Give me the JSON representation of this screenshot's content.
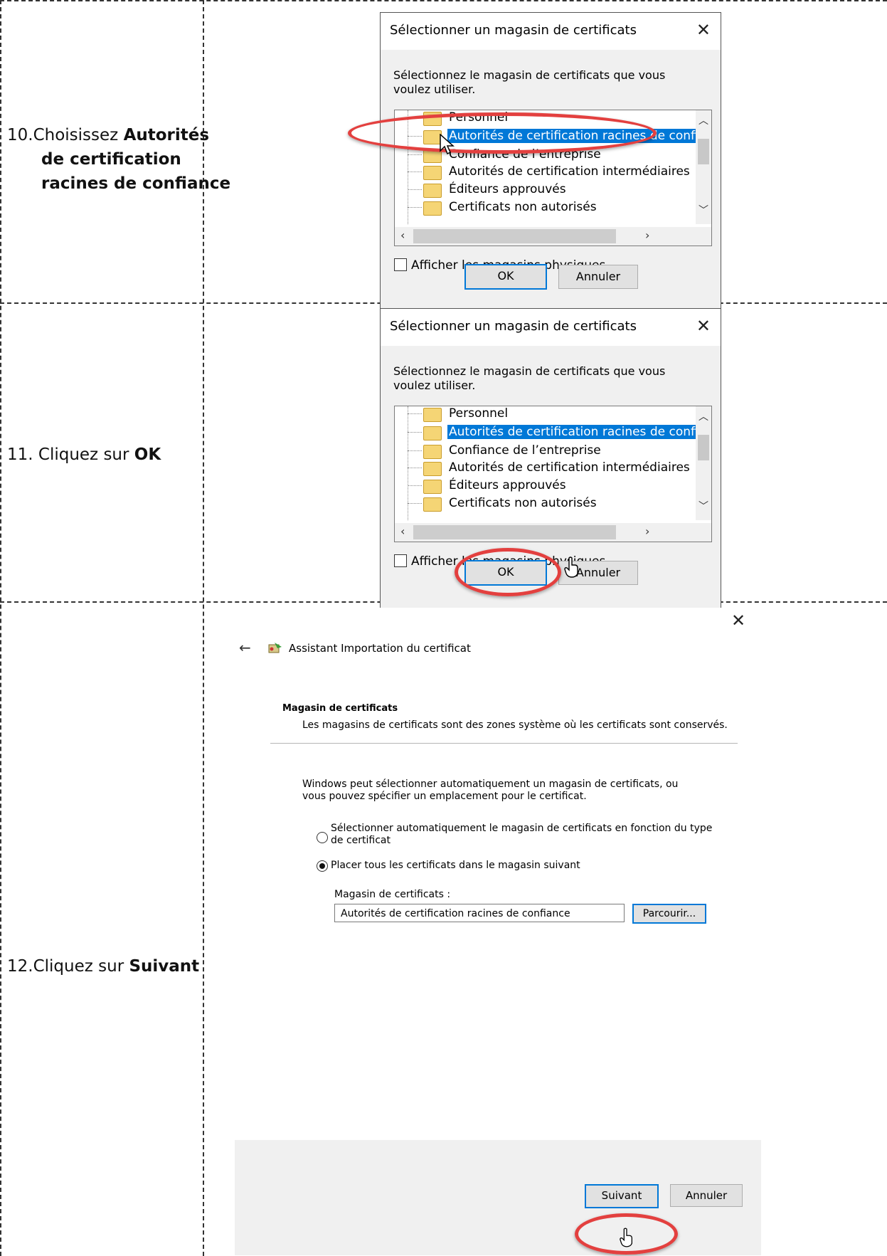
{
  "rows": [
    {
      "step_prefix": "10.Choisissez ",
      "step_bold_1": "Autorités",
      "step_bold_2": "de certification",
      "step_bold_3": "racines de confiance"
    },
    {
      "step_prefix": "11. Cliquez sur ",
      "step_bold": "OK"
    },
    {
      "step_prefix": "12.Cliquez sur ",
      "step_bold": "Suivant"
    }
  ],
  "dialog": {
    "title": "Sélectionner un magasin de certificats",
    "close_glyph": "✕",
    "description": "Sélectionnez le magasin de certificats que vous voulez utiliser.",
    "stores": [
      "Personnel",
      "Autorités de certification racines de confi",
      "Confiance de l’entreprise",
      "Autorités de certification intermédiaires",
      "Éditeurs approuvés",
      "Certificats non autorisés"
    ],
    "selected_index": 1,
    "show_physical_label": "Afficher les magasins physiques",
    "ok_label": "OK",
    "cancel_label": "Annuler"
  },
  "wizard": {
    "close_glyph": "✕",
    "back_glyph": "←",
    "title": "Assistant Importation du certificat",
    "section_title": "Magasin de certificats",
    "section_desc": "Les magasins de certificats sont des zones système où les certificats sont conservés.",
    "intro": "Windows peut sélectionner automatiquement un magasin de certificats, ou vous pouvez spécifier un emplacement pour le certificat.",
    "option_auto": "Sélectionner automatiquement le magasin de certificats en fonction du type de certificat",
    "option_manual": "Placer tous les certificats dans le magasin suivant",
    "selected_option": "manual",
    "store_label": "Magasin de certificats :",
    "store_value": "Autorités de certification racines de confiance",
    "browse_label": "Parcourir...",
    "next_label": "Suivant",
    "cancel_label": "Annuler"
  },
  "colors": {
    "highlight": "#0078d7",
    "annotation_ring": "#e3403f",
    "folder": "#f5d575"
  }
}
